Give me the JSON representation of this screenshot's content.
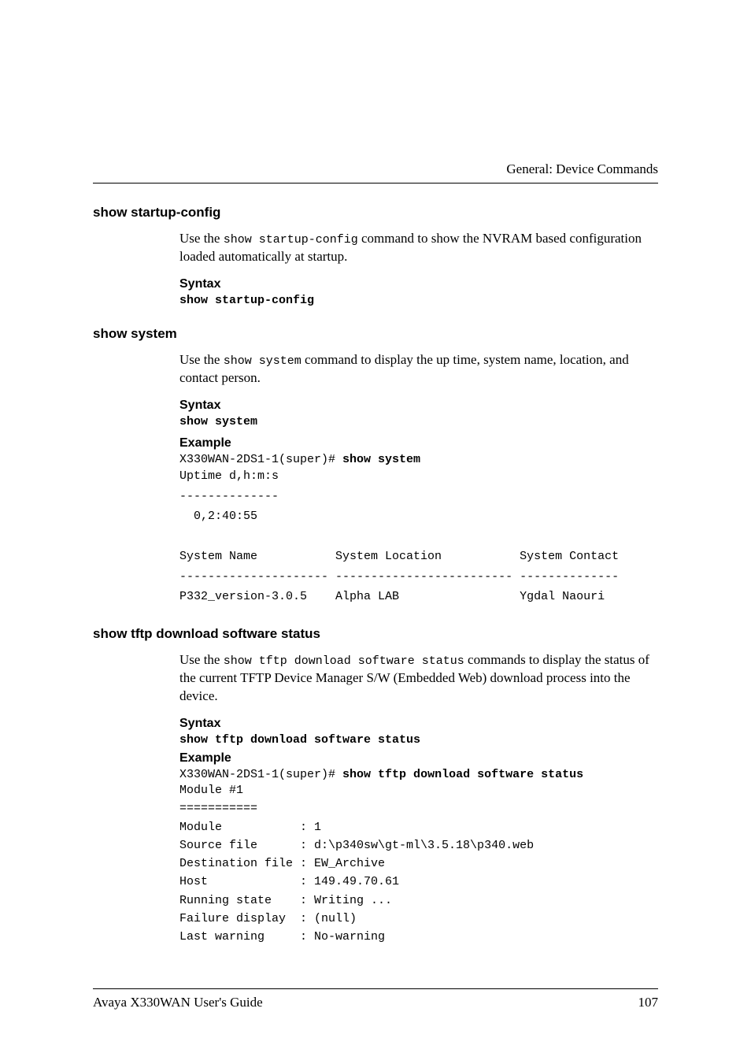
{
  "header": {
    "chapter": "General: Device Commands"
  },
  "sections": [
    {
      "title": "show startup-config",
      "desc_pre": "Use the ",
      "desc_code": "show startup-config",
      "desc_post": " command to show the NVRAM based configuration loaded automatically at startup.",
      "syntax_label": "Syntax",
      "syntax_code": "show startup-config"
    },
    {
      "title": "show system",
      "desc_pre": "Use the ",
      "desc_code": "show system",
      "desc_post": " command to display the up time, system name, location, and contact person.",
      "syntax_label": "Syntax",
      "syntax_code": "show system",
      "example_label": "Example",
      "example_prompt": "X330WAN-2DS1-1(super)# ",
      "example_cmd": "show system",
      "example_body": "Uptime d,h:m:s\n--------------\n  0,2:40:55\n\nSystem Name           System Location           System Contact\n--------------------- ------------------------- --------------\nP332_version-3.0.5    Alpha LAB                 Ygdal Naouri"
    },
    {
      "title": "show tftp download software status",
      "desc_pre": "Use the ",
      "desc_code": "show tftp download software status",
      "desc_post": " commands to display the status of the current TFTP Device Manager S/W (Embedded Web) download process into the device.",
      "syntax_label": "Syntax",
      "syntax_code": "show tftp download software status",
      "example_label": "Example",
      "example_prompt": "X330WAN-2DS1-1(super)# ",
      "example_cmd": "show tftp download software status",
      "example_body": "Module #1\n===========\nModule           : 1\nSource file      : d:\\p340sw\\gt-ml\\3.5.18\\p340.web\nDestination file : EW_Archive\nHost             : 149.49.70.61\nRunning state    : Writing ...\nFailure display  : (null)\nLast warning     : No-warning"
    }
  ],
  "footer": {
    "left": "Avaya X330WAN User's Guide",
    "right": "107"
  }
}
